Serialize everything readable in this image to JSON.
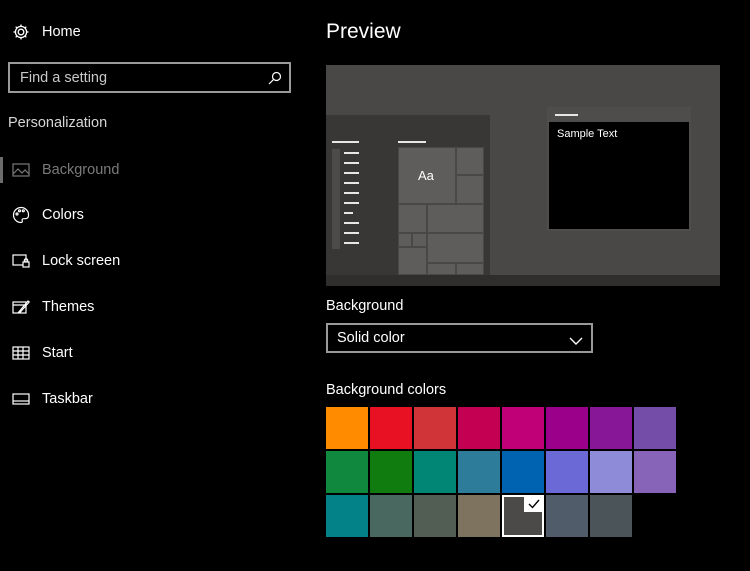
{
  "sidebar": {
    "home_label": "Home",
    "search_placeholder": "Find a setting",
    "section_title": "Personalization",
    "items": [
      {
        "label": "Background",
        "icon": "picture-icon",
        "state": "disabled"
      },
      {
        "label": "Colors",
        "icon": "palette-icon"
      },
      {
        "label": "Lock screen",
        "icon": "lock-screen-icon"
      },
      {
        "label": "Themes",
        "icon": "themes-icon"
      },
      {
        "label": "Start",
        "icon": "start-icon"
      },
      {
        "label": "Taskbar",
        "icon": "taskbar-icon"
      }
    ]
  },
  "main": {
    "title": "Preview",
    "preview": {
      "tile_text": "Aa",
      "window_text": "Sample Text"
    },
    "background_label": "Background",
    "background_value": "Solid color",
    "colors_label": "Background colors",
    "swatches": [
      "#ff8c00",
      "#e81123",
      "#d13438",
      "#c30052",
      "#bf0077",
      "#9a0089",
      "#881798",
      "#744da9",
      "#10893e",
      "#107c10",
      "#018574",
      "#2d7d9a",
      "#0063b1",
      "#6b69d6",
      "#8e8cd8",
      "#8764b8",
      "#038387",
      "#486860",
      "#525e54",
      "#7e735f",
      "#4c4a48",
      "#515c6b",
      "#4a5459"
    ],
    "selected_swatch_index": 20
  }
}
